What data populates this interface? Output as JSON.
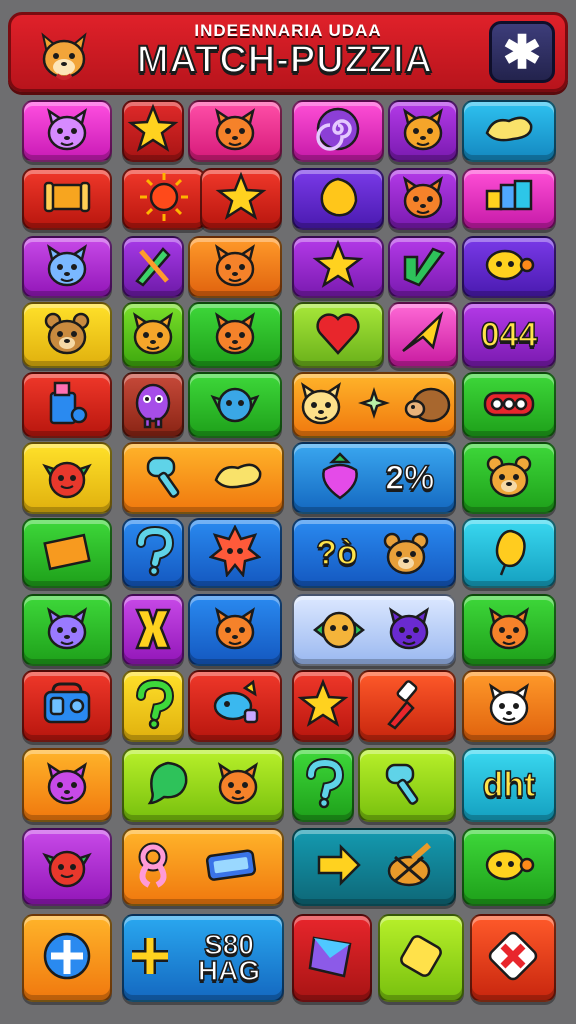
{
  "header": {
    "subtitle": "INDEENNARIA UDAA",
    "title": "MATCH-PUZZIA",
    "menu_symbol": "✱",
    "logo_icon": "fox-mascot-icon"
  },
  "colors": {
    "header_red": "#d81e25",
    "background": "#6e6e70"
  },
  "tiles": {
    "r1": [
      "cat-face-icon",
      "star-icon",
      "fox-face-icon",
      "swirl-icon",
      "house-cat-icon",
      "bread-icon"
    ],
    "r2": [
      "scroll-icon",
      "sun-icon",
      "star-icon",
      "lemon-icon",
      "cat-face-icon",
      "blocks-icon"
    ],
    "r3": [
      "cat-face-icon",
      "pencil-icon",
      "fox-face-icon",
      "star-icon",
      "check-icon",
      "face-icon"
    ],
    "r4": [
      "bear-face-icon",
      "fox-face-icon",
      "fox-face-icon",
      "heart-icon",
      "arrow-icon"
    ],
    "r4_text": "044",
    "r5": [
      "cup-icon",
      "monster-icon",
      "creature-icon",
      "cat-face-icon",
      "sparkle-icon",
      "hedgehog-icon",
      "buttons-icon"
    ],
    "r6": [
      "tomato-icon",
      "hammer-icon",
      "bread-icon",
      "radish-icon",
      "bear-face-icon"
    ],
    "r6_text": "2%",
    "r7": [
      "envelope-icon",
      "question-icon",
      "sun-creature-icon",
      "bear-face-icon",
      "balloon-icon"
    ],
    "r7_text": "?ò",
    "r8": [
      "cat-face-icon",
      "puzzle-icon",
      "fox-face-icon",
      "bird-icon",
      "cat-face-icon",
      "fox-face-icon"
    ],
    "r9": [
      "radio-icon",
      "question-icon",
      "fish-icon",
      "star-icon",
      "brush-icon",
      "cat-face-icon"
    ],
    "r10": [
      "cat-face-icon",
      "leaf-icon",
      "fox-face-icon",
      "question-icon",
      "hammer-icon"
    ],
    "r10_text": "dht",
    "r11": [
      "tomato-icon",
      "ribbon-icon",
      "battery-icon",
      "arrow-right-icon",
      "basket-icon",
      "face-icon"
    ],
    "r12": [
      "plus-icon",
      "plus-icon",
      "diamond-icon",
      "gem-icon",
      "x-icon"
    ],
    "r12_text": "S80 HAG"
  }
}
